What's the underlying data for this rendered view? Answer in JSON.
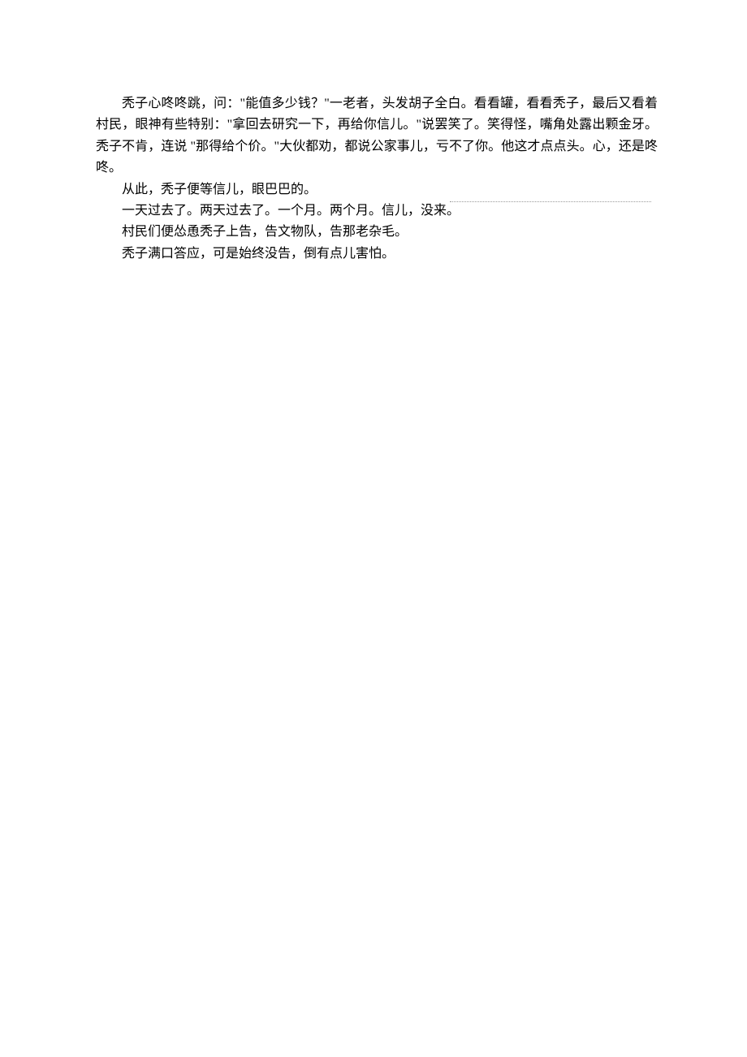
{
  "paragraphs": [
    "秃子心咚咚跳，问：\"能值多少钱？\"一老者，头发胡子全白。看看罐，看看秃子，最后又看着村民，眼神有些特别：\"拿回去研究一下，再给你信儿。\"说罢笑了。笑得怪，嘴角处露出颗金牙。秃子不肯，连说 \"那得给个价。\"大伙都劝，都说公家事儿，亏不了你。他这才点点头。心，还是咚咚。",
    "从此，秃子便等信儿，眼巴巴的。",
    "一天过去了。两天过去了。一个月。两个月。信儿，没来。",
    "村民们便怂恿秃子上告，告文物队，告那老杂毛。",
    "秃子满口答应，可是始终没告，倒有点儿害怕。"
  ]
}
